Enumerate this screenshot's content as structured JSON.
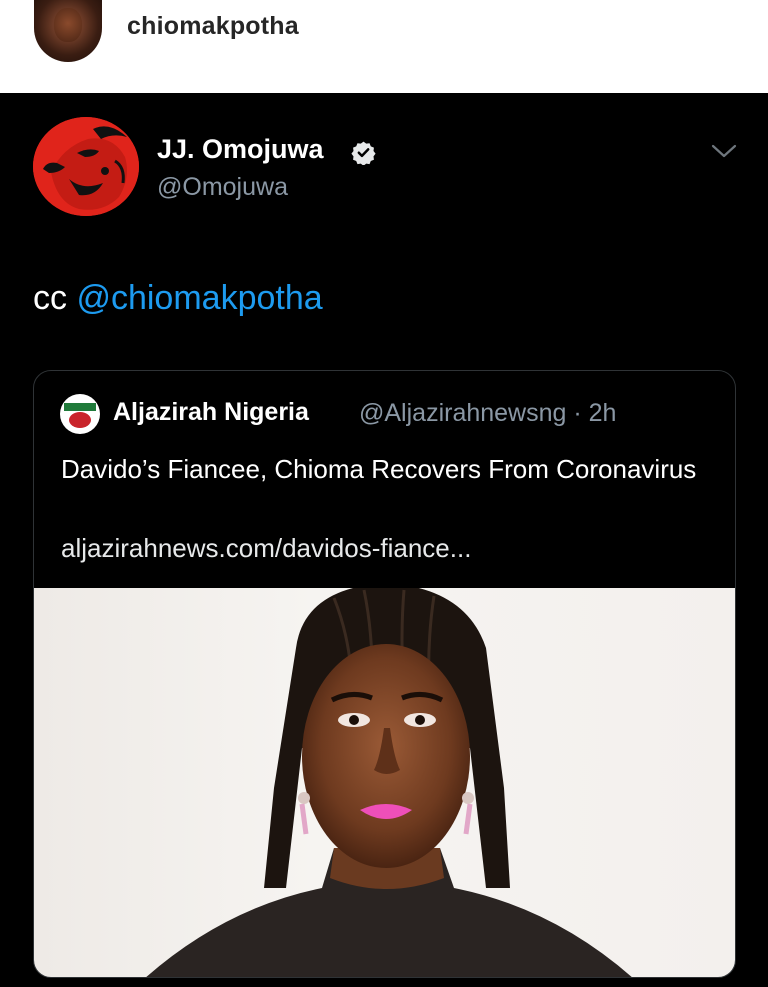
{
  "instagram": {
    "username": "chiomakpotha"
  },
  "tweet": {
    "author_name": "JJ. Omojuwa",
    "author_handle": "@Omojuwa",
    "text_prefix": "cc ",
    "mention": "@chiomakpotha",
    "verified_icon": "verified-badge-icon",
    "menu_icon": "chevron-down-icon"
  },
  "quoted_tweet": {
    "author_name": "Aljazirah Nigeria",
    "author_handle_time": "@Aljazirahnewsng · 2h",
    "headline": "Davido’s Fiancee, Chioma Recovers From Coronavirus",
    "link": "aljazirahnews.com/davidos-fiance..."
  },
  "colors": {
    "tweet_background": "#000000",
    "mention_blue": "#1d9bf0",
    "secondary_text": "#8b98a5",
    "avatar_red": "#e0241b"
  }
}
